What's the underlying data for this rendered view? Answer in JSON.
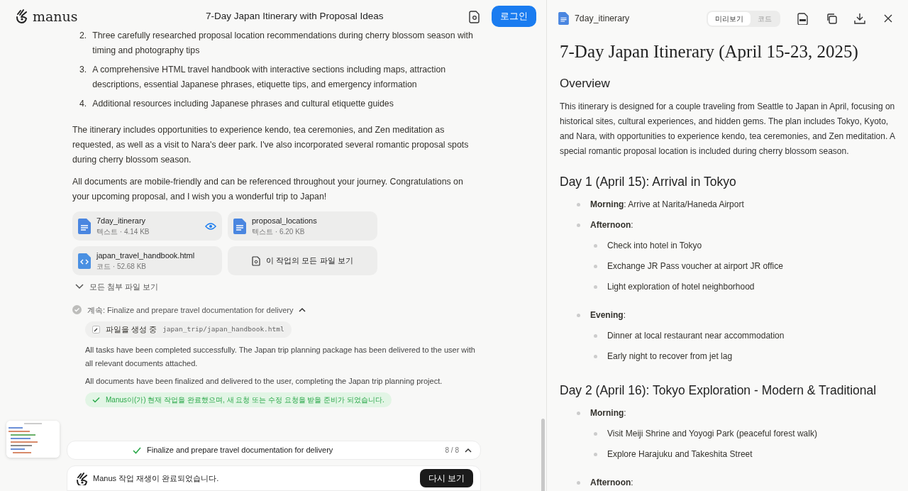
{
  "header": {
    "logo": "manus",
    "title": "7-Day Japan Itinerary with Proposal Ideas",
    "login_button": "로그인"
  },
  "message": {
    "list_items": [
      {
        "number": "2.",
        "text": "Three carefully researched proposal location recommendations during cherry blossom season with timing and photography tips"
      },
      {
        "number": "3.",
        "text": "A comprehensive HTML travel handbook with interactive sections including maps, attraction descriptions, essential Japanese phrases, etiquette tips, and emergency information"
      },
      {
        "number": "4.",
        "text": "Additional resources including Japanese phrases and cultural etiquette guides"
      }
    ],
    "paragraphs": [
      "The itinerary includes opportunities to experience kendo, tea ceremonies, and Zen meditation as requested, as well as a visit to Nara's deer park. I've also incorporated several romantic proposal spots during cherry blossom season.",
      "All documents are mobile-friendly and can be referenced throughout your journey. Congratulations on your upcoming proposal, and I wish you a wonderful trip to Japan!"
    ]
  },
  "attachments": [
    {
      "name": "7day_itinerary",
      "meta": "텍스트 · 4.14 KB",
      "kind": "text",
      "previewing": true
    },
    {
      "name": "proposal_locations",
      "meta": "텍스트 · 6.20 KB",
      "kind": "text",
      "previewing": false
    },
    {
      "name": "japan_travel_handbook.html",
      "meta": "코드 · 52.68 KB",
      "kind": "code",
      "previewing": false
    }
  ],
  "all_files_button": "이 작업의 모든 파일 보기",
  "show_all_attachments": "모든 첨부 파일 보기",
  "step": {
    "title": "계속: Finalize and prepare travel documentation for delivery",
    "expanded": true,
    "action": {
      "label": "파일을 생성 중",
      "path": "japan_trip/japan_handbook.html"
    },
    "paragraphs": [
      "All tasks have been completed successfully. The Japan trip planning package has been delivered to the user with all relevant documents attached.",
      "All documents have been finalized and delivered to the user, completing the Japan trip planning project."
    ],
    "done_message": "Manus이(가) 현재 작업을 완료했으며, 새 요청 또는 수정 요청을 받을 준비가 되었습니다."
  },
  "progress": {
    "title": "Finalize and prepare travel documentation for delivery",
    "count": "8 / 8"
  },
  "replay": {
    "message": "Manus 작업 재생이 완료되었습니다.",
    "button": "다시 보기"
  },
  "preview": {
    "file_name": "7day_itinerary",
    "tabs": [
      {
        "label": "미리보기",
        "selected": true
      },
      {
        "label": "코드",
        "selected": false
      }
    ],
    "document": {
      "title": "7-Day Japan Itinerary (April 15-23, 2025)",
      "sections": [
        {
          "heading": "Overview",
          "paragraph": "This itinerary is designed for a couple traveling from Seattle to Japan in April, focusing on historical sites, cultural experiences, and hidden gems. The plan includes Tokyo, Kyoto, and Nara, with opportunities to experience kendo, tea ceremonies, and Zen meditation. A special romantic proposal location is included during cherry blossom season."
        },
        {
          "heading": "Day 1 (April 15): Arrival in Tokyo",
          "items": [
            {
              "text": "**Morning**: Arrive at Narita/Haneda Airport"
            },
            {
              "text": "**Afternoon**:",
              "children": [
                {
                  "text": "Check into hotel in Tokyo"
                },
                {
                  "text": "Exchange JR Pass voucher at airport JR office"
                },
                {
                  "text": "Light exploration of hotel neighborhood"
                }
              ]
            },
            {
              "text": "**Evening**:",
              "children": [
                {
                  "text": "Dinner at local restaurant near accommodation"
                },
                {
                  "text": "Early night to recover from jet lag"
                }
              ]
            }
          ]
        },
        {
          "heading": "Day 2 (April 16): Tokyo Exploration - Modern & Traditional",
          "items": [
            {
              "text": "**Morning**:",
              "children": [
                {
                  "text": "Visit Meiji Shrine and Yoyogi Park (peaceful forest walk)"
                },
                {
                  "text": "Explore Harajuku and Takeshita Street"
                }
              ]
            },
            {
              "text": "**Afternoon**:"
            }
          ]
        }
      ]
    }
  }
}
